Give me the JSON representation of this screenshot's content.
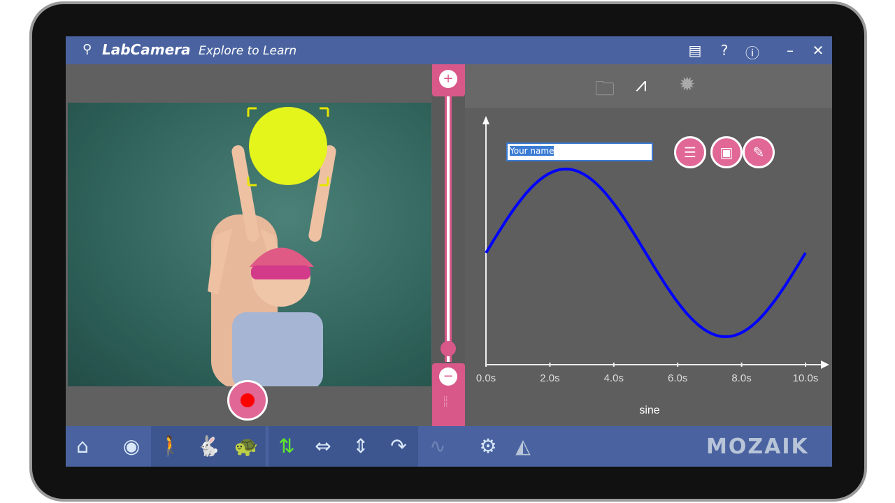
{
  "window": {
    "title": "LabCamera",
    "subtitle": "Explore to Learn"
  },
  "titlebar_icons": [
    "notebook-icon",
    "help-icon",
    "info-icon",
    "minimize-icon",
    "close-icon"
  ],
  "graph_toolbar": [
    "folder-open-icon",
    "graph-axes-icon",
    "new-burst-icon"
  ],
  "name_field": {
    "value": "Your name"
  },
  "graph_buttons": [
    "list-icon",
    "save-icon",
    "pencil-icon"
  ],
  "bottom_toolbar": [
    "home-icon",
    "webcam-icon",
    "walking-person-icon",
    "rabbit-icon",
    "turtle-icon",
    "flip-icon",
    "horizontal-arrows-icon",
    "vertical-arrows-icon",
    "rotate-icon",
    "sine-wave-icon",
    "camera-settings-icon",
    "mirror-icon"
  ],
  "brand": "MOZAIK",
  "colors": {
    "accent": "#d9588a",
    "titlebar": "#4a63a0",
    "curve": "#0000ff",
    "active_icon": "#5ee82a"
  },
  "chart_data": {
    "type": "line",
    "title": "",
    "xlabel": "sine",
    "ylabel": "",
    "xlim": [
      0,
      10
    ],
    "x_ticks": [
      "0.0s",
      "2.0s",
      "4.0s",
      "6.0s",
      "8.0s",
      "10.0s"
    ],
    "series": [
      {
        "x": [
          0,
          0.5,
          1,
          1.5,
          2,
          2.5,
          3,
          3.5,
          4,
          4.5,
          5,
          5.5,
          6,
          6.5,
          7,
          7.5,
          8,
          8.5,
          9,
          9.5,
          10
        ],
        "y": [
          0,
          0.309,
          0.588,
          0.809,
          0.951,
          1,
          0.951,
          0.809,
          0.588,
          0.309,
          0,
          -0.309,
          -0.588,
          -0.809,
          -0.951,
          -1,
          -0.951,
          -0.809,
          -0.588,
          -0.309,
          0
        ]
      }
    ]
  }
}
